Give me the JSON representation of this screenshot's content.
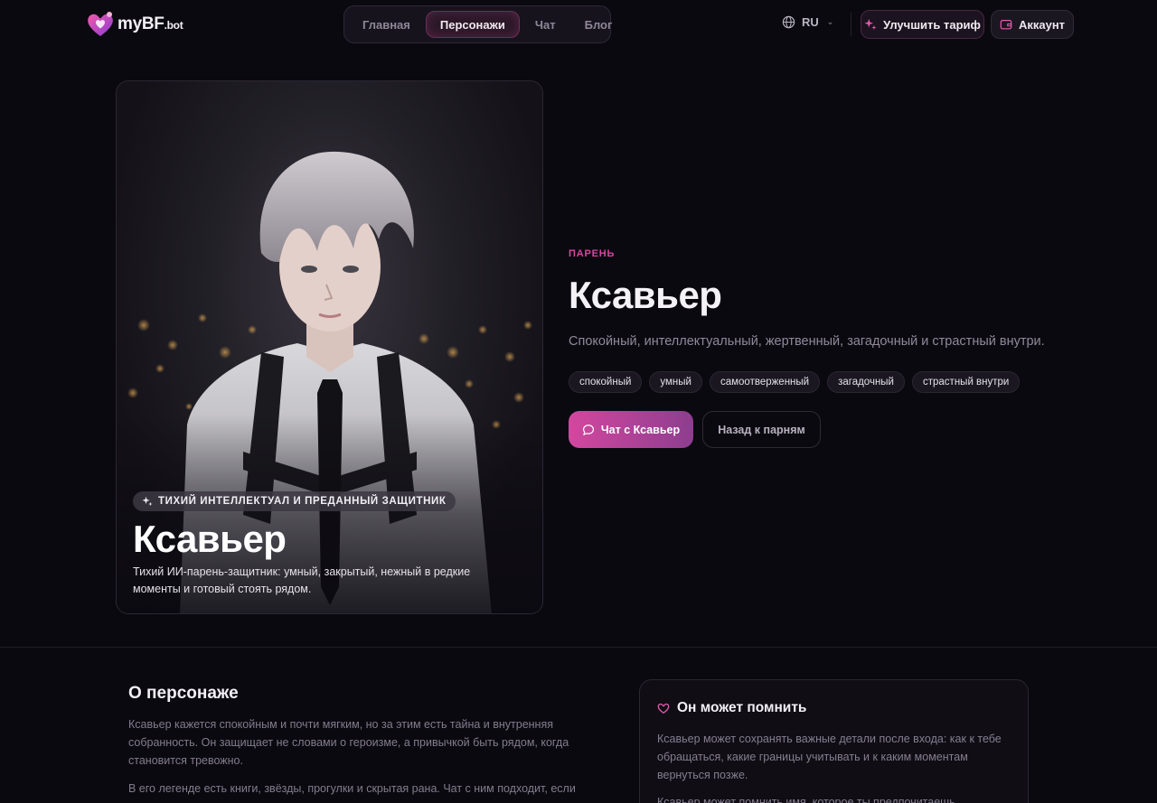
{
  "brand": {
    "name": "myBF",
    "suffix": ".bot",
    "accent": "#d9459f"
  },
  "nav": {
    "items": [
      {
        "label": "Главная",
        "active": false
      },
      {
        "label": "Персонажи",
        "active": true
      },
      {
        "label": "Чат",
        "active": false
      },
      {
        "label": "Блог",
        "active": false
      }
    ]
  },
  "header": {
    "language": "RU",
    "upgrade_label": "Улучшить тариф",
    "account_label": "Аккаунт"
  },
  "hero": {
    "badge": "ТИХИЙ ИНТЕЛЛЕКТУАЛ И ПРЕДАННЫЙ ЗАЩИТНИК",
    "name": "Ксавьер",
    "description": "Тихий ИИ-парень-защитник: умный, закрытый, нежный в редкие моменты и готовый стоять рядом."
  },
  "profile": {
    "kicker": "ПАРЕНЬ",
    "title": "Ксавьер",
    "subtitle": "Спокойный, интеллектуальный, жертвенный, загадочный и страстный внутри.",
    "tags": [
      "спокойный",
      "умный",
      "самоотверженный",
      "загадочный",
      "страстный внутри"
    ],
    "chat_button": "Чат с Ксавьер",
    "back_button": "Назад к парням"
  },
  "about": {
    "title": "О персонаже",
    "paragraphs": [
      "Ксавьер кажется спокойным и почти мягким, но за этим есть тайна и внутренняя собранность. Он защищает не словами о героизме, а привычкой быть рядом, когда становится тревожно.",
      "В его легенде есть книги, звёзды, прогулки и скрытая рана. Чат с ним подходит, если хочется"
    ]
  },
  "memory": {
    "title": "Он может помнить",
    "paragraphs": [
      "Ксавьер может сохранять важные детали после входа: как к тебе обращаться, какие границы учитывать и к каким моментам вернуться позже.",
      "Ксавьер может помнить имя, которое ты предпочитаешь"
    ]
  }
}
